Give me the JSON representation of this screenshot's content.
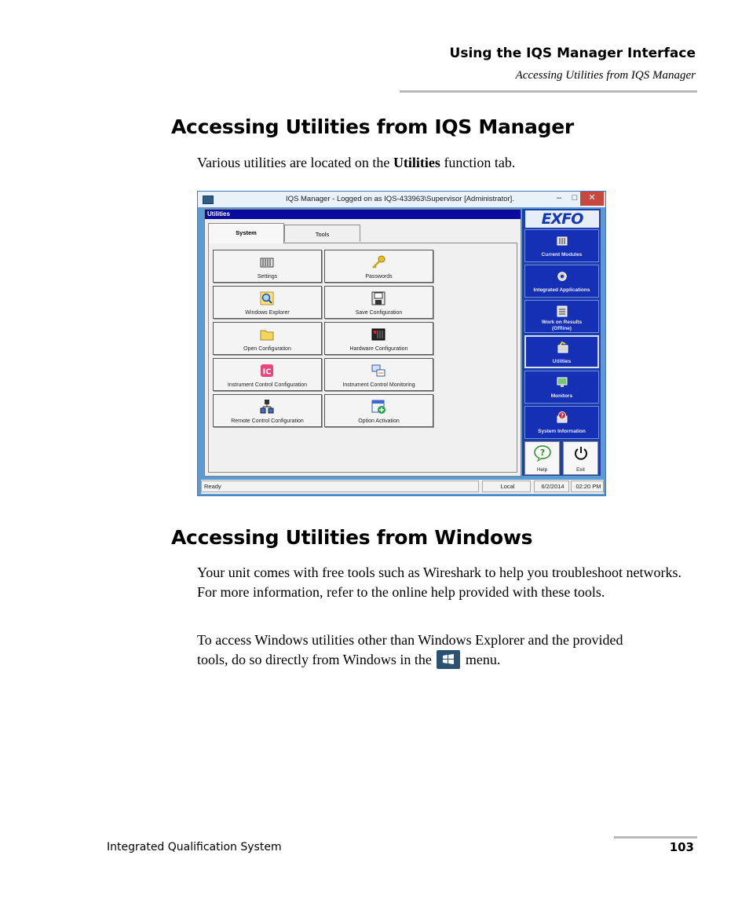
{
  "running_header": {
    "title": "Using the IQS Manager Interface",
    "subtitle": "Accessing Utilities from IQS Manager"
  },
  "section1": {
    "heading": "Accessing Utilities from IQS Manager",
    "intro_before": "Various utilities are located on the ",
    "intro_bold": "Utilities",
    "intro_after": " function tab."
  },
  "screenshot": {
    "window_title": "IQS Manager - Logged on as IQS-433963\\Supervisor [Administrator].",
    "panel_title": "Utilities",
    "tabs": [
      "System",
      "Tools"
    ],
    "utilities": [
      {
        "label": "Settings",
        "icon": "settings-icon"
      },
      {
        "label": "Passwords",
        "icon": "key-icon"
      },
      {
        "label": "Windows Explorer",
        "icon": "magnifier-icon"
      },
      {
        "label": "Save Configuration",
        "icon": "floppy-icon"
      },
      {
        "label": "Open Configuration",
        "icon": "folder-icon"
      },
      {
        "label": "Hardware Configuration",
        "icon": "hardware-icon"
      },
      {
        "label": "Instrument Control Configuration",
        "icon": "ic-icon"
      },
      {
        "label": "Instrument Control Monitoring",
        "icon": "monitoring-icon"
      },
      {
        "label": "Remote Control Configuration",
        "icon": "network-icon"
      },
      {
        "label": "Option Activation",
        "icon": "option-add-icon"
      }
    ],
    "logo": "EXFO",
    "side_buttons": [
      {
        "label": "Current Modules",
        "icon": "modules-icon"
      },
      {
        "label": "Integrated Applications",
        "icon": "applications-icon"
      },
      {
        "label_line1": "Work on Results",
        "label_line2": "(Offline)",
        "icon": "results-icon"
      },
      {
        "label": "Utilities",
        "icon": "utilities-icon"
      },
      {
        "label": "Monitors",
        "icon": "monitors-icon"
      },
      {
        "label": "System Information",
        "icon": "system-info-icon"
      }
    ],
    "help_label": "Help",
    "exit_label": "Exit",
    "status": {
      "state": "Ready",
      "mode": "Local",
      "date": "6/2/2014",
      "time": "02:20 PM"
    }
  },
  "section2": {
    "heading": "Accessing Utilities from Windows",
    "para1": "Your unit comes with free tools such as Wireshark to help you troubleshoot networks. For more information, refer to the online help provided with these tools.",
    "para2_before": "To access Windows utilities other than Windows Explorer and the provided tools, do so directly from Windows in the",
    "para2_after": "menu."
  },
  "footer": {
    "left": "Integrated Qualification System",
    "page": "103"
  },
  "colors": {
    "side_panel": "#1530b5",
    "panel_title_bar": "#0a0a9e",
    "window_frame": "#5b9bd5"
  }
}
